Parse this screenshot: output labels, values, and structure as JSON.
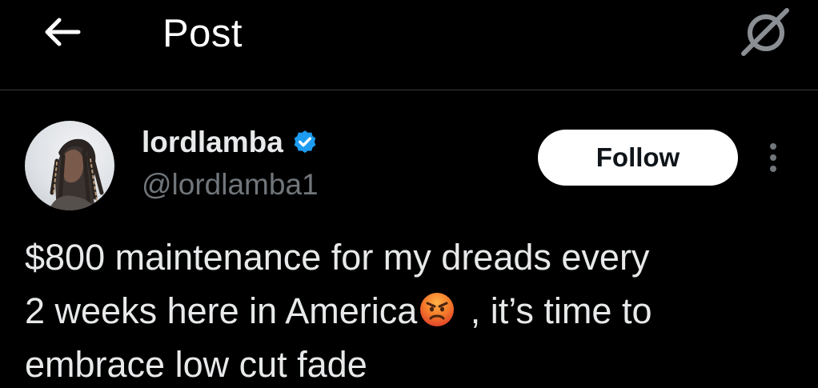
{
  "header": {
    "title": "Post",
    "back_icon": "arrow-left-icon",
    "grok_icon": "grok-icon"
  },
  "author": {
    "display_name": "lordlamba",
    "handle": "@lordlamba1",
    "verified": true,
    "verified_color": "#1d9bf0"
  },
  "actions": {
    "follow_label": "Follow",
    "more_icon": "more-vertical-icon"
  },
  "post": {
    "text_line_1": "$800 maintenance for my dreads every",
    "text_line_2_before": "2 weeks here in America",
    "emoji": "angry-face",
    "text_line_2_after": " , it’s time to",
    "text_line_3": "embrace low cut fade"
  },
  "colors": {
    "background": "#000000",
    "text_primary": "#e7e9ea",
    "text_secondary": "#71767b",
    "divider": "#3a3b3d"
  }
}
